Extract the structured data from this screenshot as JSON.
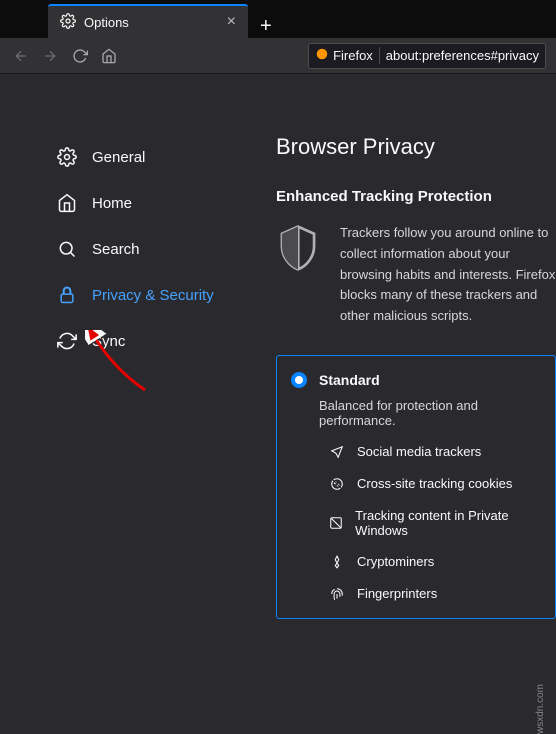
{
  "tab": {
    "title": "Options",
    "close_glyph": "×"
  },
  "new_tab_glyph": "+",
  "url": {
    "identity_label": "Firefox",
    "path": "about:preferences#privacy"
  },
  "sidebar": {
    "items": [
      {
        "label": "General"
      },
      {
        "label": "Home"
      },
      {
        "label": "Search"
      },
      {
        "label": "Privacy & Security"
      },
      {
        "label": "Sync"
      }
    ]
  },
  "main": {
    "heading": "Browser Privacy",
    "subheading": "Enhanced Tracking Protection",
    "description": "Trackers follow you around online to collect information about your browsing habits and interests. Firefox blocks many of these trackers and other malicious scripts.",
    "card": {
      "title": "Standard",
      "desc": "Balanced for protection and performance.",
      "items": [
        "Social media trackers",
        "Cross-site tracking cookies",
        "Tracking content in Private Windows",
        "Cryptominers",
        "Fingerprinters"
      ]
    }
  },
  "watermark": "wsxdn.com"
}
